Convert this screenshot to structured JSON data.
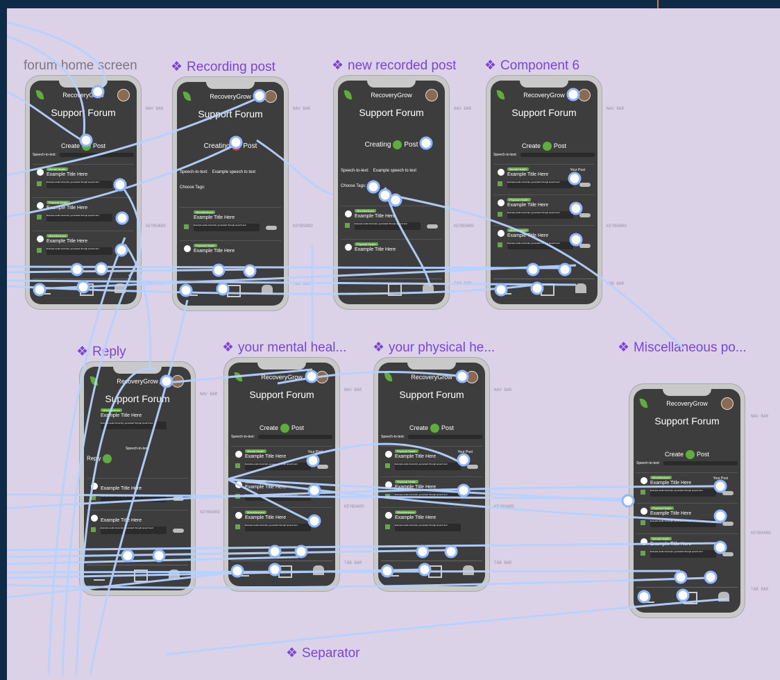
{
  "frame_labels": {
    "home": "forum home screen",
    "recording": "Recording post",
    "new_recorded": "new recorded post",
    "component6": "Component 6",
    "reply": "Reply",
    "mental": "your mental heal...",
    "physical": "your physical he...",
    "misc": "Miscellaneous po...",
    "separator": "Separator"
  },
  "icons": {
    "diamond": "❖"
  },
  "side_labels": {
    "nav": "NAV BAR",
    "keyboard": "KEYBOARD",
    "tab": "TAB BAR"
  },
  "app": {
    "name": "RecoveryGrow",
    "forum_title": "Support Forum",
    "create": "Create",
    "post": "Post",
    "creating": "Creating",
    "speech_to_text": "Speech-to-text:",
    "example_speech": "Example speech to text",
    "choose_tags": "Choose Tags:",
    "your_post": "Your Post",
    "reply_label": "Reply",
    "post_title": "Example Title Here",
    "transcript": "Example audio transcript, generated through speech-text",
    "tags": [
      "Mental Health",
      "Physical Health",
      "Miscellaneous"
    ]
  },
  "colors": {
    "accent": "#7a45d6",
    "brand_green": "#5fae3c",
    "canvas": "#dcd2e8",
    "wire": "#b4d2ff"
  }
}
